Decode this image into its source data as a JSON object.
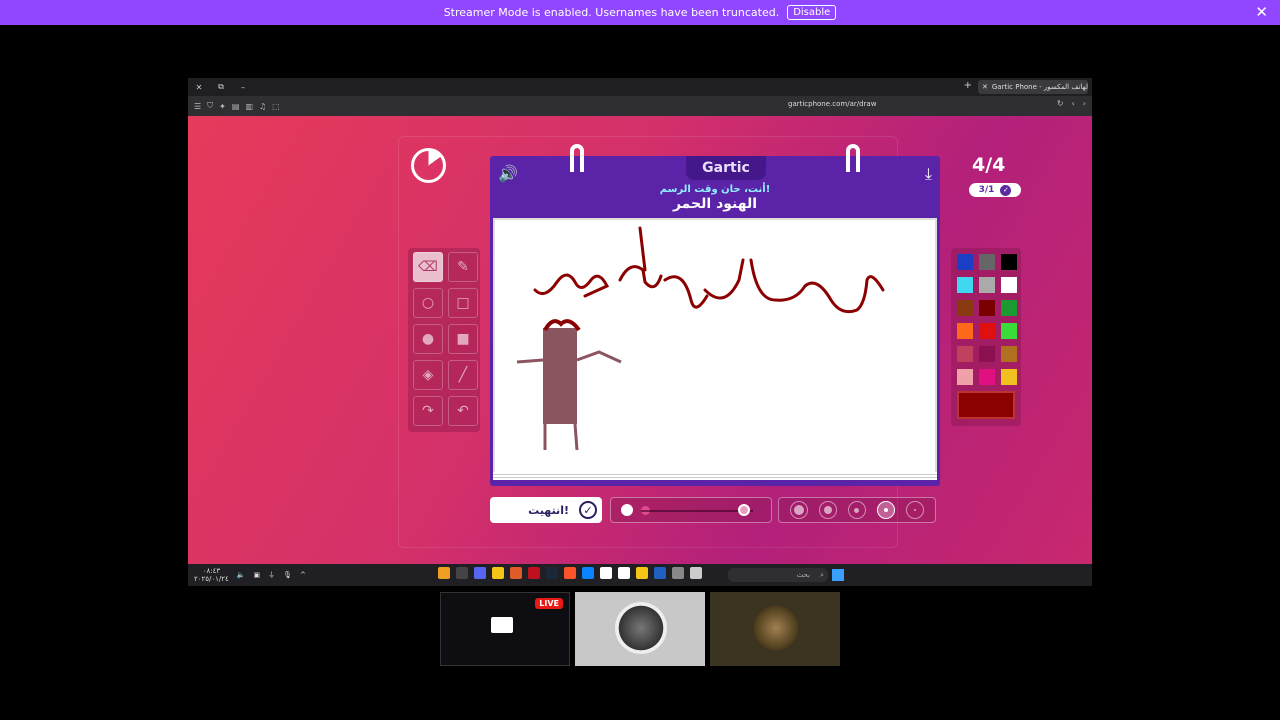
{
  "banner": {
    "text": "Streamer Mode is enabled. Usernames have been truncated.",
    "disable_label": "Disable",
    "close_icon": "✕"
  },
  "browser": {
    "tab_title": "Gartic Phone - الهاتف المكسور",
    "url": "garticphone.com/ar/draw",
    "new_tab_icon": "+"
  },
  "game": {
    "logo": "Gartic",
    "round": "4/4",
    "round_sub": "3/1",
    "prompt_sub": "أنت، حان وقت الرسم!",
    "prompt_main": "الهنود الحمر",
    "done_label": "انتهيت!",
    "tools": [
      "eraser",
      "pencil",
      "circle-outline",
      "rect-outline",
      "circle-fill",
      "rect-fill",
      "bucket",
      "line",
      "undo",
      "redo"
    ],
    "palette": [
      "#1a3fc4",
      "#666666",
      "#000000",
      "#3fd8f0",
      "#aaaaaa",
      "#ffffff",
      "#8a3a10",
      "#7a0000",
      "#1a9a30",
      "#ff6a1a",
      "#e01010",
      "#3adc3a",
      "#c04060",
      "#8a1050",
      "#b07020",
      "#f0a0a8",
      "#e01080",
      "#f0c020"
    ],
    "current_color": "#8b0000",
    "opacity_level": 0.92,
    "selected_brush_size": 4
  },
  "taskbar": {
    "search_placeholder": "بحث",
    "time": "٠٨:٤٣",
    "date": "٢٠٢٥/٠١/٢٤"
  },
  "stream": {
    "live_label": "LIVE"
  },
  "colors": {
    "brand_purple": "#9146ff",
    "notebook_purple": "#5a23a8",
    "live_red": "#e91916"
  }
}
